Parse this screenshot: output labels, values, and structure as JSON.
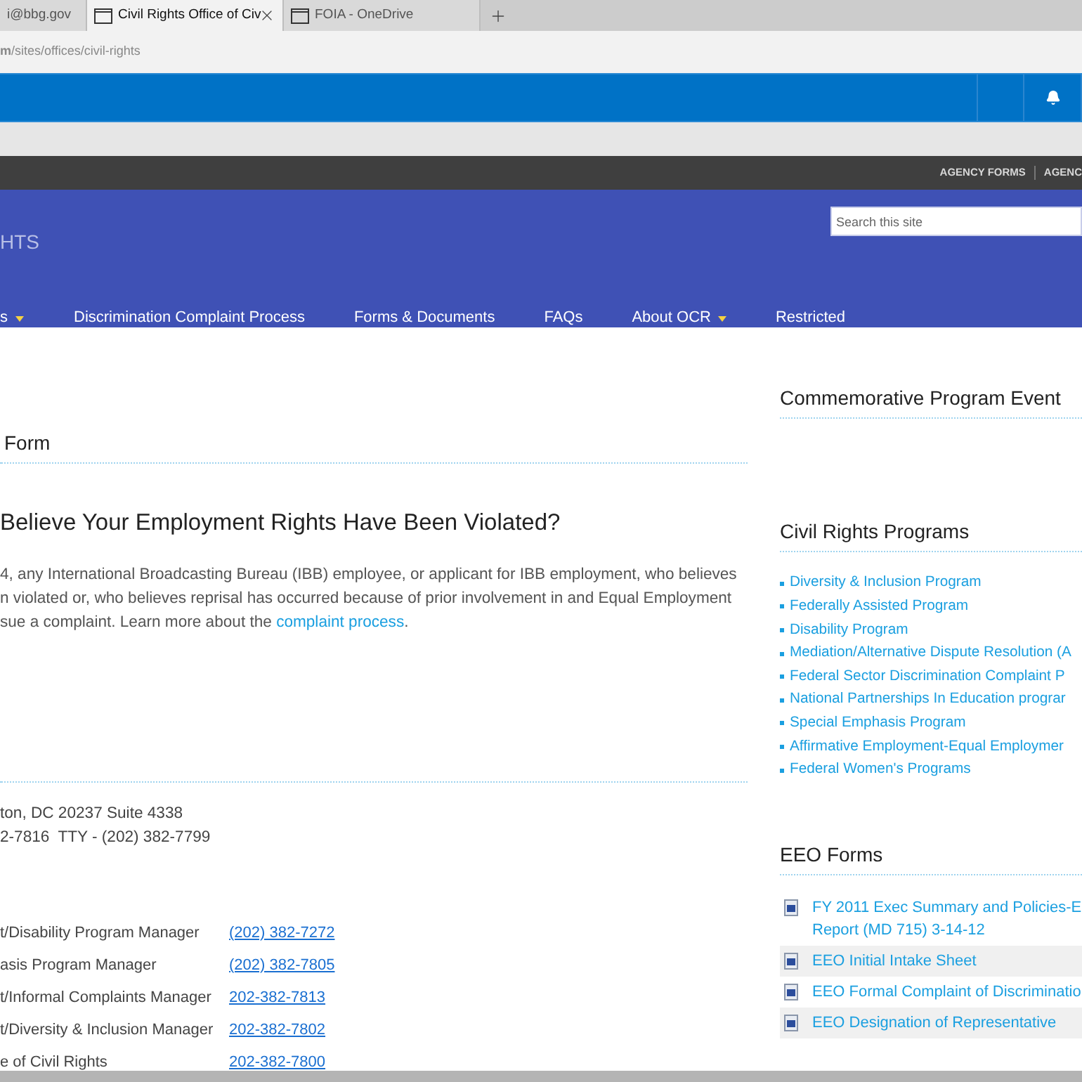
{
  "browser": {
    "tabs": [
      {
        "title": "i@bbg.gov",
        "selected": false,
        "icon": false
      },
      {
        "title": "Civil Rights Office of Civ",
        "selected": true,
        "icon": true
      },
      {
        "title": "FOIA - OneDrive",
        "selected": false,
        "icon": true
      }
    ],
    "address": "**m**/sites/offices/civil-rights"
  },
  "utility_bar": {
    "links": [
      "AGENCY FORMS",
      "AGENC"
    ]
  },
  "site": {
    "title": "HTS",
    "search": {
      "placeholder": "Search this site"
    },
    "nav": [
      {
        "label": "s",
        "dropdown": true
      },
      {
        "label": "Discrimination Complaint Process",
        "dropdown": false
      },
      {
        "label": "Forms & Documents",
        "dropdown": false
      },
      {
        "label": "FAQs",
        "dropdown": false
      },
      {
        "label": "About OCR",
        "dropdown": true
      },
      {
        "label": "Restricted",
        "dropdown": false
      }
    ]
  },
  "main": {
    "section_title": "Form",
    "heading": "Believe Your Employment Rights Have Been Violated?",
    "paragraph": {
      "lines": [
        "4, any International Broadcasting Bureau (IBB) employee, or applicant for IBB employment, who believes",
        "n violated or, who believes reprisal has occurred because of prior involvement in and Equal Employment",
        "sue a complaint. Learn more about the "
      ],
      "link": "complaint process",
      "end": "."
    },
    "address": [
      "ton, DC 20237 Suite 4338",
      "2-7816  TTY - (202) 382-7799"
    ],
    "contacts": [
      {
        "role": "t/Disability Program Manager",
        "phone": "(202) 382-7272"
      },
      {
        "role": "asis Program Manager",
        "phone": "(202) 382-7805"
      },
      {
        "role": "t/Informal Complaints Manager",
        "phone": "202-382-7813"
      },
      {
        "role": "t/Diversity & Inclusion Manager",
        "phone": "202-382-7802"
      },
      {
        "role": "e of Civil Rights",
        "phone": "202-382-7800"
      }
    ]
  },
  "sidebar": {
    "events_title": "Commemorative Program Event",
    "programs_title": "Civil Rights Programs",
    "programs": [
      "Diversity & Inclusion Program",
      "Federally Assisted Program",
      "Disability Program",
      "Mediation/Alternative Dispute Resolution (A",
      "Federal Sector Discrimination Complaint P",
      "National Partnerships In Education prograr",
      "Special Emphasis Program",
      "Affirmative Employment-Equal Employmer",
      "Federal Women's Programs"
    ],
    "forms_title": "EEO Forms",
    "forms": [
      {
        "lines": [
          "FY 2011 Exec Summary and Policies-E",
          "Report (MD 715) 3-14-12"
        ],
        "shaded": false
      },
      {
        "lines": [
          "EEO Initial Intake Sheet"
        ],
        "shaded": true
      },
      {
        "lines": [
          "EEO Formal Complaint of Discriminatio"
        ],
        "shaded": false
      },
      {
        "lines": [
          "EEO Designation of Representative"
        ],
        "shaded": true
      }
    ]
  }
}
